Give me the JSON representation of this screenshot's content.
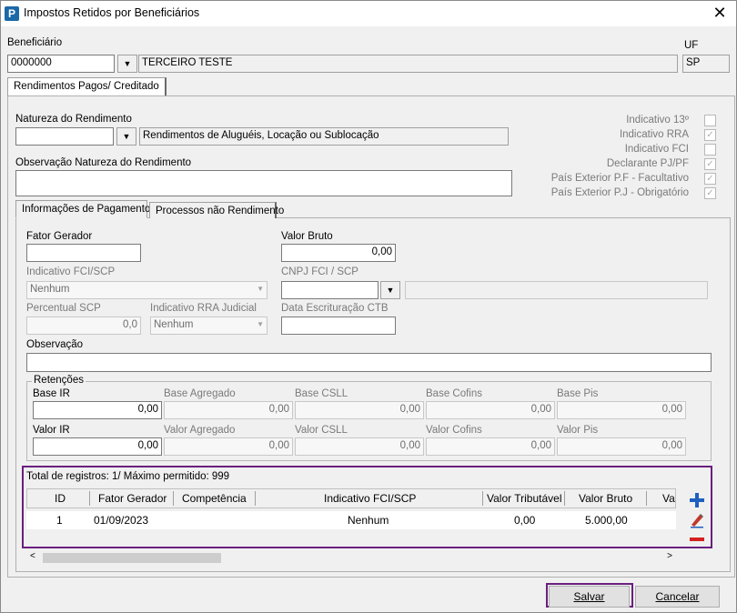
{
  "window": {
    "title": "Impostos Retidos por Beneficiários",
    "app_icon_text": "P",
    "close_glyph": "✕"
  },
  "beneficiario": {
    "label": "Beneficiário",
    "code": "0000000",
    "name": "TERCEIRO TESTE",
    "uf_label": "UF",
    "uf": "SP"
  },
  "main_tab": {
    "label": "Rendimentos Pagos/ Creditado"
  },
  "natureza": {
    "label": "Natureza do Rendimento",
    "code": "",
    "description": "Rendimentos de Aluguéis, Locação ou Sublocação"
  },
  "observacao_natureza": {
    "label": "Observação Natureza do Rendimento",
    "value": ""
  },
  "checks": [
    {
      "label": "Indicativo 13º",
      "checked": false
    },
    {
      "label": "Indicativo RRA",
      "checked": true
    },
    {
      "label": "Indicativo FCI",
      "checked": false
    },
    {
      "label": "Declarante PJ/PF",
      "checked": true
    },
    {
      "label": "País Exterior P.F - Facultativo",
      "checked": true
    },
    {
      "label": "País Exterior P.J - Obrigatório",
      "checked": true
    }
  ],
  "sub_tabs": {
    "pagamento": "Informações de Pagamento",
    "processos": "Processos não Rendimento"
  },
  "pagamento": {
    "fator_gerador_label": "Fator Gerador",
    "fator_gerador": "",
    "valor_bruto_label": "Valor Bruto",
    "valor_bruto": "0,00",
    "ind_fci_label": "Indicativo FCI/SCP",
    "ind_fci": "Nenhum",
    "cnpj_label": "CNPJ FCI / SCP",
    "cnpj": "",
    "percentual_label": "Percentual SCP",
    "percentual": "0,0",
    "rra_label": "Indicativo RRA Judicial",
    "rra": "Nenhum",
    "data_escrit_label": "Data Escrituração CTB",
    "data_escrit": "",
    "observacao_label": "Observação",
    "observacao": ""
  },
  "retencoes": {
    "legend": "Retenções",
    "row1": [
      {
        "label": "Base IR",
        "value": "0,00"
      },
      {
        "label": "Base Agregado",
        "value": "0,00"
      },
      {
        "label": "Base CSLL",
        "value": "0,00"
      },
      {
        "label": "Base Cofins",
        "value": "0,00"
      },
      {
        "label": "Base Pis",
        "value": "0,00"
      }
    ],
    "row2": [
      {
        "label": "Valor IR",
        "value": "0,00"
      },
      {
        "label": "Valor Agregado",
        "value": "0,00"
      },
      {
        "label": "Valor CSLL",
        "value": "0,00"
      },
      {
        "label": "Valor Cofins",
        "value": "0,00"
      },
      {
        "label": "Valor Pis",
        "value": "0,00"
      }
    ]
  },
  "grid": {
    "summary": "Total de registros: 1/ Máximo permitido: 999",
    "columns": [
      "ID",
      "Fator Gerador",
      "Competência",
      "Indicativo FCI/SCP",
      "Valor Tributável",
      "Valor Bruto",
      "Val"
    ],
    "rows": [
      {
        "id": "1",
        "fator_gerador": "01/09/2023",
        "competencia": "",
        "indicativo": "Nenhum",
        "valor_tributavel": "0,00",
        "valor_bruto": "5.000,00"
      }
    ]
  },
  "icons": {
    "add": "plus-icon",
    "edit": "edit-icon",
    "remove": "minus-icon"
  },
  "colors": {
    "highlight": "#6a1f7e",
    "add": "#1f5fbf",
    "remove": "#d42020"
  },
  "buttons": {
    "save": "Salvar",
    "cancel": "Cancelar"
  }
}
